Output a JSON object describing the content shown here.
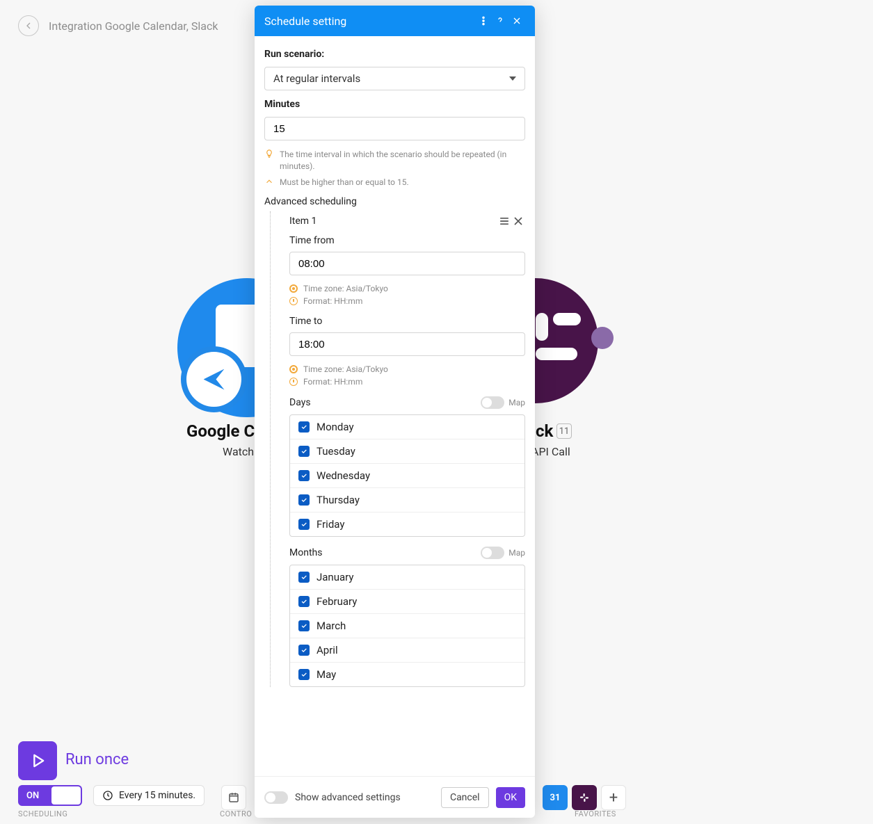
{
  "topbar": {
    "title": "Integration Google Calendar, Slack"
  },
  "bg": {
    "gcal_title": "Google C",
    "gcal_sub": "Watch",
    "slack_title": "ck",
    "slack_badge": "11",
    "slack_sub": "API Call"
  },
  "bottom": {
    "run_once": "Run once",
    "on": "ON",
    "interval": "Every 15 minutes.",
    "cap_scheduling": "SCHEDULING",
    "cap_control": "CONTRO",
    "cap_favorites": "FAVORITES",
    "gcal_tile": "31"
  },
  "modal": {
    "title": "Schedule setting",
    "run_scenario_label": "Run scenario:",
    "run_scenario_value": "At regular intervals",
    "minutes_label": "Minutes",
    "minutes_value": "15",
    "hint_interval": "The time interval in which the scenario should be repeated (in minutes).",
    "hint_min": "Must be higher than or equal to 15.",
    "advanced_label": "Advanced scheduling",
    "item": {
      "title": "Item 1",
      "time_from_label": "Time from",
      "time_from_value": "08:00",
      "time_to_label": "Time to",
      "time_to_value": "18:00",
      "tz": "Time zone: Asia/Tokyo",
      "fmt": "Format: HH:mm",
      "days_label": "Days",
      "map_label": "Map",
      "days": [
        "Monday",
        "Tuesday",
        "Wednesday",
        "Thursday",
        "Friday"
      ],
      "months_label": "Months",
      "months": [
        "January",
        "February",
        "March",
        "April",
        "May"
      ]
    },
    "show_advanced": "Show advanced settings",
    "cancel": "Cancel",
    "ok": "OK"
  }
}
